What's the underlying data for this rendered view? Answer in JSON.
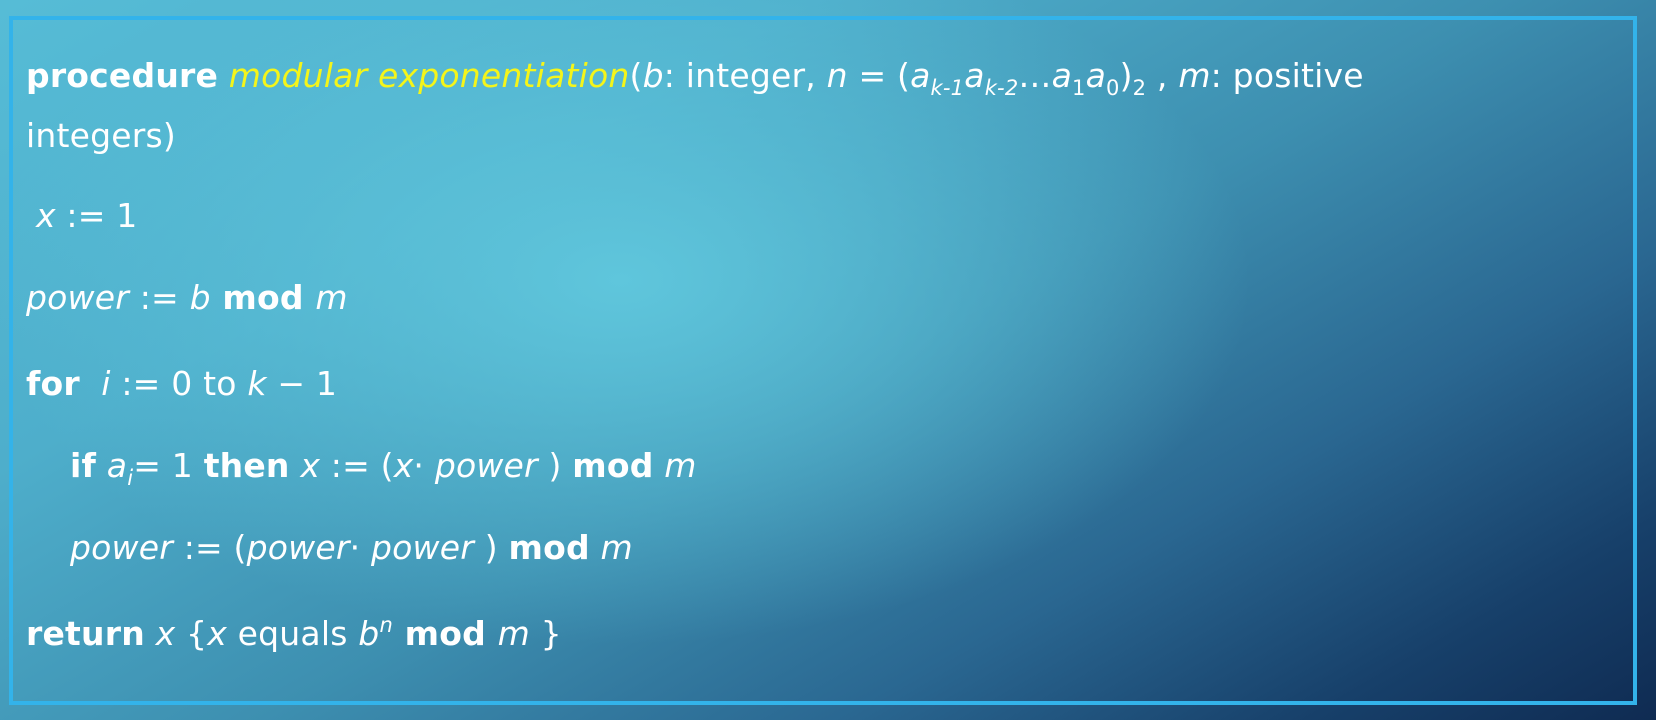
{
  "procedure_header": {
    "kw_procedure": "procedure",
    "name": "modular exponentiation",
    "open_paren": "(",
    "param_b": "b",
    "b_type": ": integer, ",
    "param_n": "n",
    "eq": " = (",
    "a1": "a",
    "a1_sub": "k-1",
    "a2": "a",
    "a2_sub": "k-2",
    "ellipsis": "…",
    "a3": "a",
    "a3_sub": "1",
    "a4": "a",
    "a4_sub": "0",
    "close_paren": ")",
    "base_sub": "2",
    "comma": " , ",
    "param_m": "m",
    "m_type": ": positive",
    "continuation": "integers)"
  },
  "line_x_init": {
    "var": "x",
    "rest": " := 1"
  },
  "line_power_init": {
    "var": "power",
    "assign": " := ",
    "b": "b",
    "kw_mod": " mod ",
    "m": "m"
  },
  "line_for": {
    "kw_for": "for",
    "var_i": "  i",
    "assign": " := 0 to ",
    "k": "k",
    "rest": " − 1"
  },
  "line_if": {
    "kw_if": "if",
    "a": " a",
    "a_sub": "i",
    "eq": "= 1 ",
    "kw_then": "then",
    "x": " x",
    "assign": " := (",
    "x2": "x",
    "dot": "· ",
    "power": "power",
    "close": " ) ",
    "kw_mod": "mod",
    "m": " m"
  },
  "line_power_update": {
    "power": "power",
    "assign": " := (",
    "power2": "power",
    "dot": "· ",
    "power3": "power",
    "close": " ) ",
    "kw_mod": "mod",
    "m": " m"
  },
  "line_return": {
    "kw_return": "return",
    "x": " x",
    "brace_open": " {",
    "x2": "x",
    "equals": " equals ",
    "b": "b",
    "n_sup": "n",
    "kw_mod": " mod ",
    "m": "m",
    "brace_close": " }"
  },
  "colors": {
    "procedure_name": "#f4f51a",
    "frame_border": "#33b3ea",
    "text": "#ffffff"
  }
}
